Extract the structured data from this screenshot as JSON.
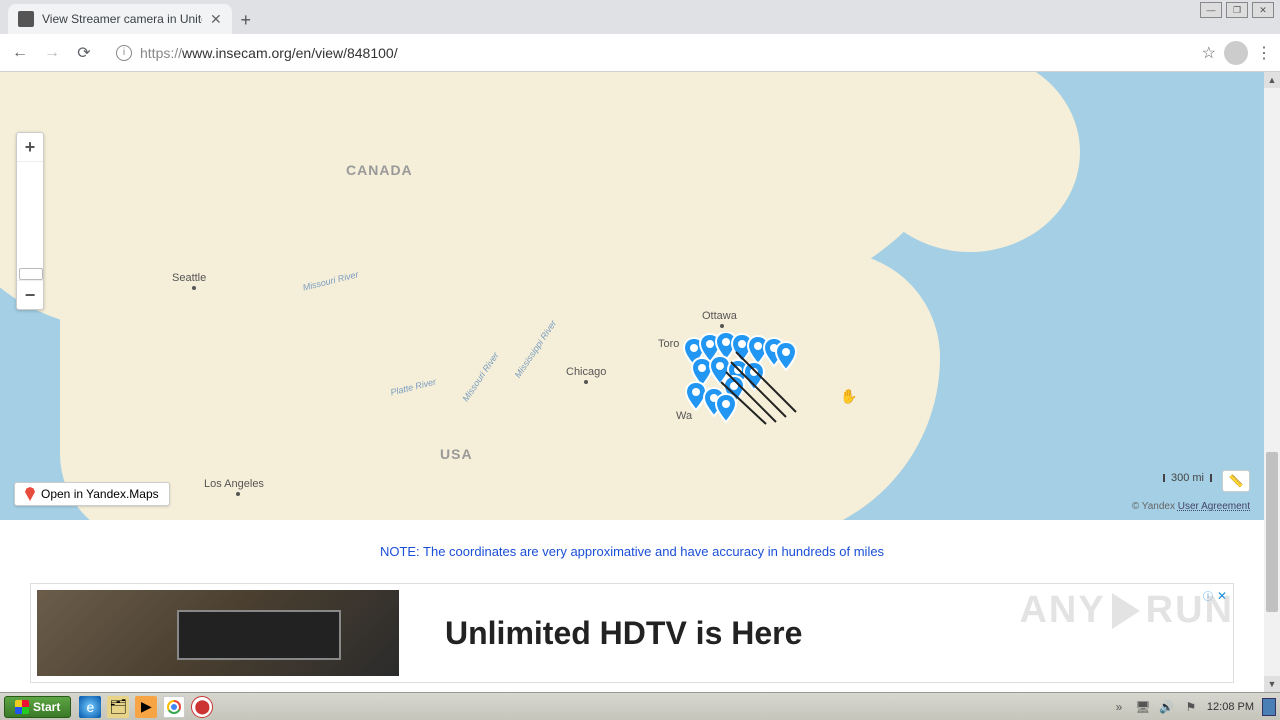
{
  "browser": {
    "tab_title": "View Streamer camera in United Stat",
    "url_proto": "https://",
    "url_rest": "www.insecam.org/en/view/848100/"
  },
  "map": {
    "labels": {
      "canada": "CANADA",
      "usa": "USA"
    },
    "cities": {
      "seattle": "Seattle",
      "ottawa": "Ottawa",
      "toronto": "Toro",
      "chicago": "Chicago",
      "los_angeles": "Los Angeles",
      "washington": "Wa"
    },
    "rivers": {
      "missouri1": "Missouri River",
      "mississippi": "Mississippi River",
      "missouri2": "Missouri River",
      "platte": "Platte River"
    },
    "open_in": "Open in Yandex.Maps",
    "scale": "300 mi",
    "attribution_prefix": "© Yandex ",
    "attribution_link": "User Agreement"
  },
  "note": "NOTE: The coordinates are very approximative and have accuracy in hundreds of miles",
  "ad": {
    "headline": "Unlimited HDTV is Here",
    "badge": "ⓘ",
    "close": "✕"
  },
  "watermark": {
    "left": "ANY",
    "right": "RUN"
  },
  "taskbar": {
    "start": "Start",
    "time": "12:08 PM"
  }
}
